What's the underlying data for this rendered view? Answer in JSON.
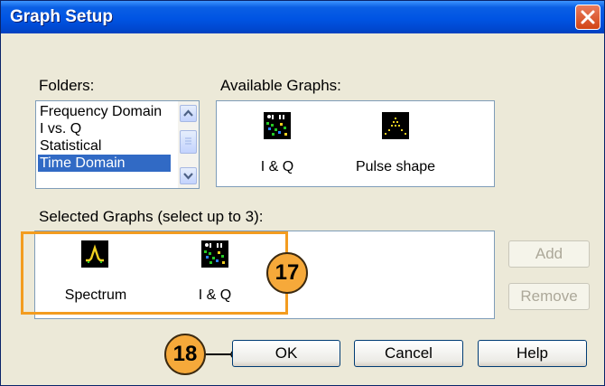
{
  "window": {
    "title": "Graph Setup"
  },
  "folders": {
    "label": "Folders:",
    "items": [
      "Frequency Domain",
      "I vs. Q",
      "Statistical",
      "Time Domain"
    ],
    "selected": "Time Domain"
  },
  "available": {
    "label": "Available Graphs:",
    "items": [
      {
        "label": "I & Q",
        "icon": "iq-graph-icon"
      },
      {
        "label": "Pulse shape",
        "icon": "pulse-shape-icon"
      }
    ]
  },
  "selected_graphs": {
    "label": "Selected Graphs (select up to 3):",
    "items": [
      {
        "label": "Spectrum",
        "icon": "spectrum-icon"
      },
      {
        "label": "I & Q",
        "icon": "iq-graph-icon"
      }
    ]
  },
  "buttons": {
    "add": "Add",
    "remove": "Remove",
    "ok": "OK",
    "cancel": "Cancel",
    "help": "Help"
  },
  "callouts": {
    "c17": "17",
    "c18": "18"
  },
  "colors": {
    "accent": "#0054e3",
    "callout": "#f6a93a",
    "selection": "#316ac5"
  }
}
